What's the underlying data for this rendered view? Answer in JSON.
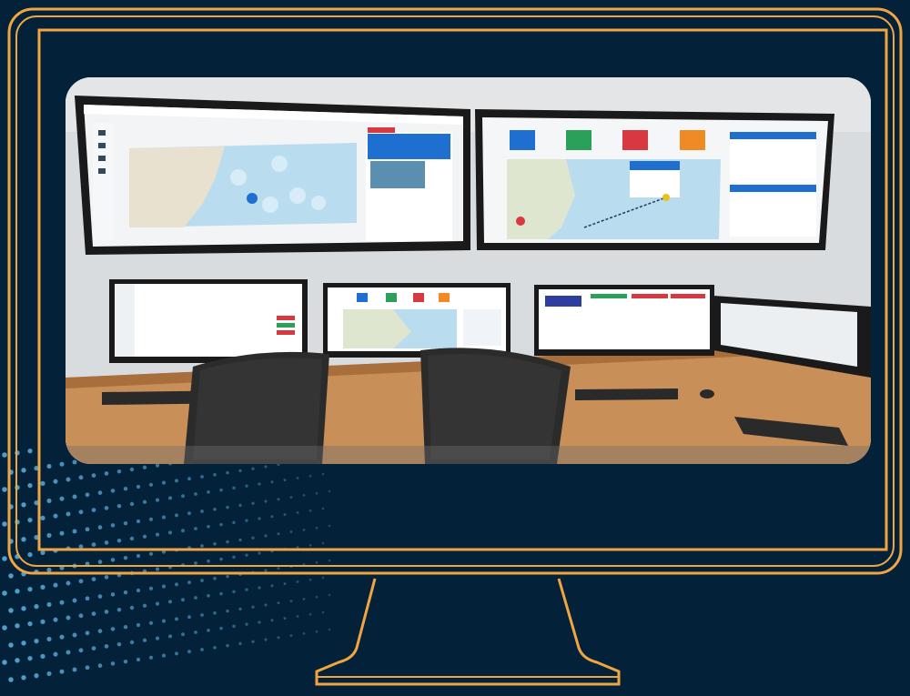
{
  "scene": {
    "description_icon": "monitor-frame-icon",
    "colors": {
      "background": "#04213a",
      "frame": "#f0a541",
      "dots": "#5fb7e6",
      "wall": "#d9dcdf",
      "desk": "#c98f58",
      "screen_bezel": "#1a1a1a",
      "map_land": "#e8e1cf",
      "map_water": "#b9dcef",
      "accent_blue": "#1f6fd1",
      "accent_red": "#d8383f",
      "accent_green": "#2aa05a",
      "accent_orange": "#f08a24"
    }
  }
}
